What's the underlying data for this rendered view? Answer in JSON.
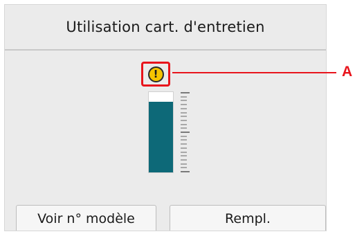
{
  "header": {
    "title": "Utilisation cart. d'entretien"
  },
  "gauge": {
    "fill_fraction": 0.88,
    "fill_color": "#0d6978",
    "warning_icon": "exclamation-warning-icon",
    "warning_color": "#f5c400"
  },
  "callout": {
    "label": "A",
    "color": "#e8141c"
  },
  "buttons": {
    "model": "Voir n° modèle",
    "replace": "Rempl."
  }
}
